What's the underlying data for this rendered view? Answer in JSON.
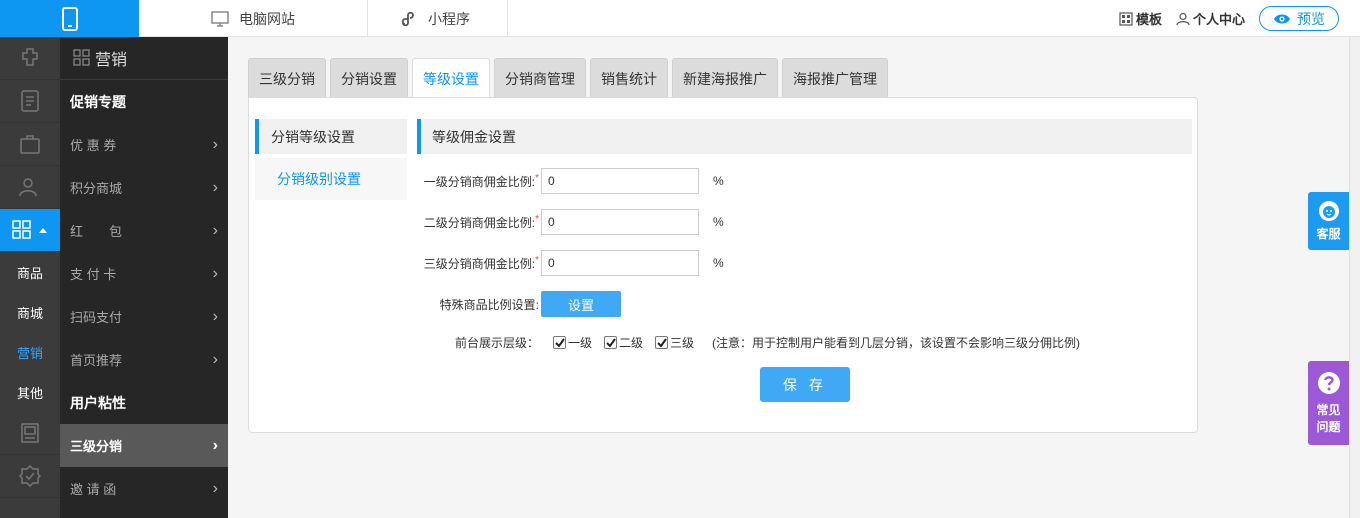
{
  "topbar": {
    "tabs": [
      {
        "label": "电脑网站",
        "icon": "monitor-icon"
      },
      {
        "label": "小程序",
        "icon": "mini-program-icon"
      }
    ],
    "template_label": "模板",
    "profile_label": "个人中心",
    "preview_label": "预览"
  },
  "icon_col": {
    "text_items": [
      "商品",
      "商城",
      "营销",
      "其他"
    ],
    "active_text": "营销"
  },
  "menu": {
    "header": "营销",
    "section1": "促销专题",
    "items1": [
      "优 惠 券",
      "积分商城",
      "红　　包",
      "支 付 卡",
      "扫码支付",
      "首页推荐"
    ],
    "section2": "用户粘性",
    "items2": [
      "三级分销",
      "邀 请 函"
    ],
    "active_item": "三级分销"
  },
  "tabs": [
    "三级分销",
    "分销设置",
    "等级设置",
    "分销商管理",
    "销售统计",
    "新建海报推广",
    "海报推广管理"
  ],
  "active_tab": "等级设置",
  "subnav": {
    "header": "分销等级设置",
    "item": "分销级别设置"
  },
  "section_title": "等级佣金设置",
  "form": {
    "level1_label": "一级分销商佣金比例:",
    "level1_value": "0",
    "level2_label": "二级分销商佣金比例:",
    "level2_value": "0",
    "level3_label": "三级分销商佣金比例:",
    "level3_value": "0",
    "unit": "%",
    "required_mark": "*",
    "special_label": "特殊商品比例设置:",
    "set_button": "设置",
    "display_label": "前台展示层级：",
    "checkboxes": [
      {
        "label": "一级",
        "checked": true
      },
      {
        "label": "二级",
        "checked": true
      },
      {
        "label": "三级",
        "checked": true
      }
    ],
    "note": "(注意：用于控制用户能看到几层分销，该设置不会影响三级分佣比例)",
    "save_button": "保 存"
  },
  "floating": {
    "service": "客服",
    "faq_line1": "常见",
    "faq_line2": "问题"
  },
  "colors": {
    "accent": "#0d96f2",
    "button": "#3fa9f5",
    "faq": "#9b59d6"
  }
}
